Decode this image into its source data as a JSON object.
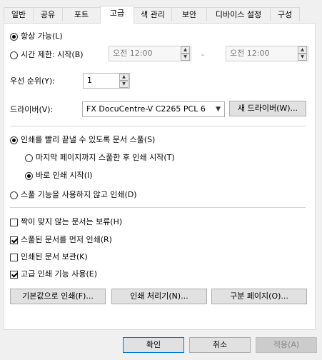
{
  "tabs": [
    "일반",
    "공유",
    "포트",
    "고급",
    "색 관리",
    "보안",
    "디바이스 설정",
    "구성"
  ],
  "availability": {
    "always_label": "항상 가능(L)",
    "time_label": "시간 제한: 시작(B)",
    "start_time": "오전 12:00",
    "dash": "-",
    "end_time": "오전 12:00"
  },
  "priority": {
    "label": "우선 순위(Y):",
    "value": "1"
  },
  "driver": {
    "label": "드라이버(V):",
    "selected": "FX DocuCentre-V C2265 PCL 6",
    "new_driver_button": "새 드라이버(W)..."
  },
  "spool": {
    "spool_label": "인쇄를 빨리 끝낼 수 있도록 문서 스풀(S)",
    "after_last_page_label": "마지막 페이지까지 스풀한 후 인쇄 시작(T)",
    "immediately_label": "바로 인쇄 시작(I)",
    "direct_label": "스풀 기능을 사용하지 않고 인쇄(D)"
  },
  "options": [
    {
      "label": "짝이 맞지 않는 문서는 보류(H)",
      "checked": false
    },
    {
      "label": "스풀된 문서를 먼저 인쇄(R)",
      "checked": true
    },
    {
      "label": "인쇄된 문서 보관(K)",
      "checked": false
    },
    {
      "label": "고급 인쇄 기능 사용(E)",
      "checked": true
    }
  ],
  "bottom_buttons": {
    "defaults": "기본값으로 인쇄(F)...",
    "processor": "인쇄 처리기(N)...",
    "separator": "구분 페이지(O)..."
  },
  "dialog_buttons": {
    "ok": "확인",
    "cancel": "취소",
    "apply": "적용(A)"
  }
}
